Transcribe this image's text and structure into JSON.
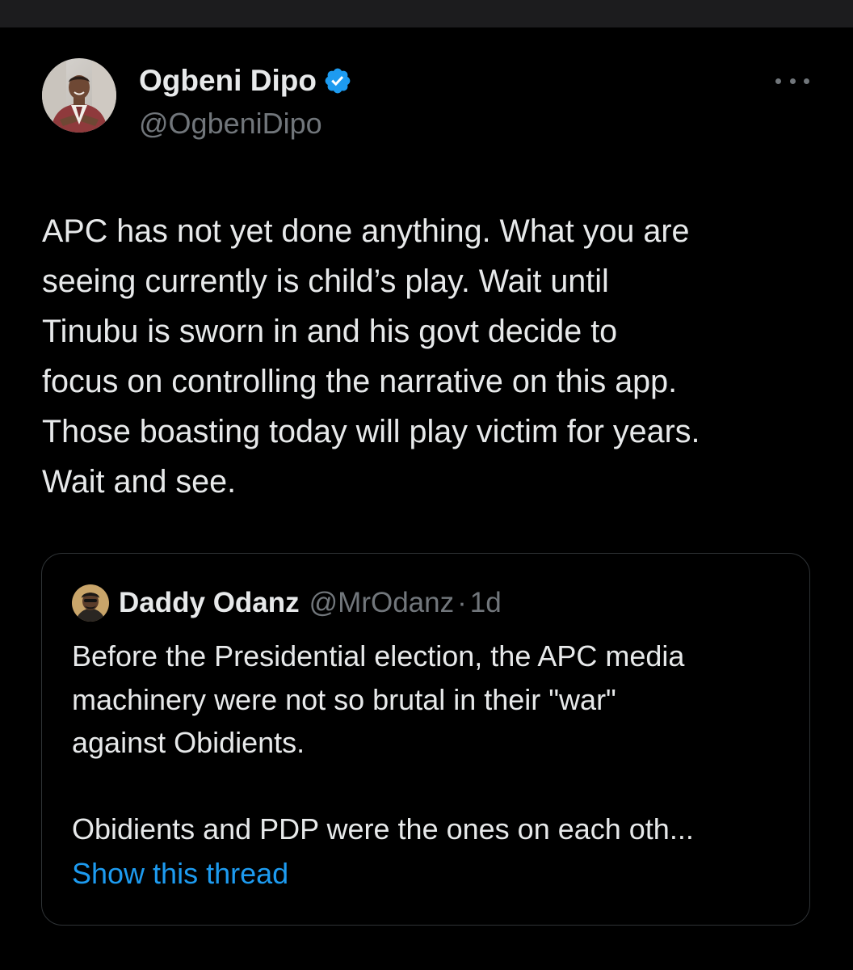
{
  "tweet": {
    "author": {
      "display_name": "Ogbeni Dipo",
      "handle": "@OgbeniDipo",
      "verified": true,
      "verified_color": "#1d9bf0"
    },
    "text": "APC has not yet done anything. What you are\nseeing currently is child’s play. Wait until\nTinubu is sworn in and his govt decide to\nfocus on controlling the narrative on this app.\nThose boasting today will play victim for years.\nWait and see.",
    "more_icon": "more-horizontal-icon"
  },
  "quote": {
    "author": {
      "display_name": "Daddy Odanz",
      "handle": "@MrOdanz",
      "separator": "·",
      "time": "1d"
    },
    "text": "Before the Presidential election, the APC media\nmachinery were not so brutal in their \"war\"\nagainst Obidients.\n\nObidients and PDP were the ones on each oth...",
    "show_thread_label": "Show this thread"
  },
  "colors": {
    "background": "#000000",
    "text_primary": "#e7e9ea",
    "text_secondary": "#71767b",
    "link": "#1d9bf0",
    "border": "#2f3336"
  }
}
